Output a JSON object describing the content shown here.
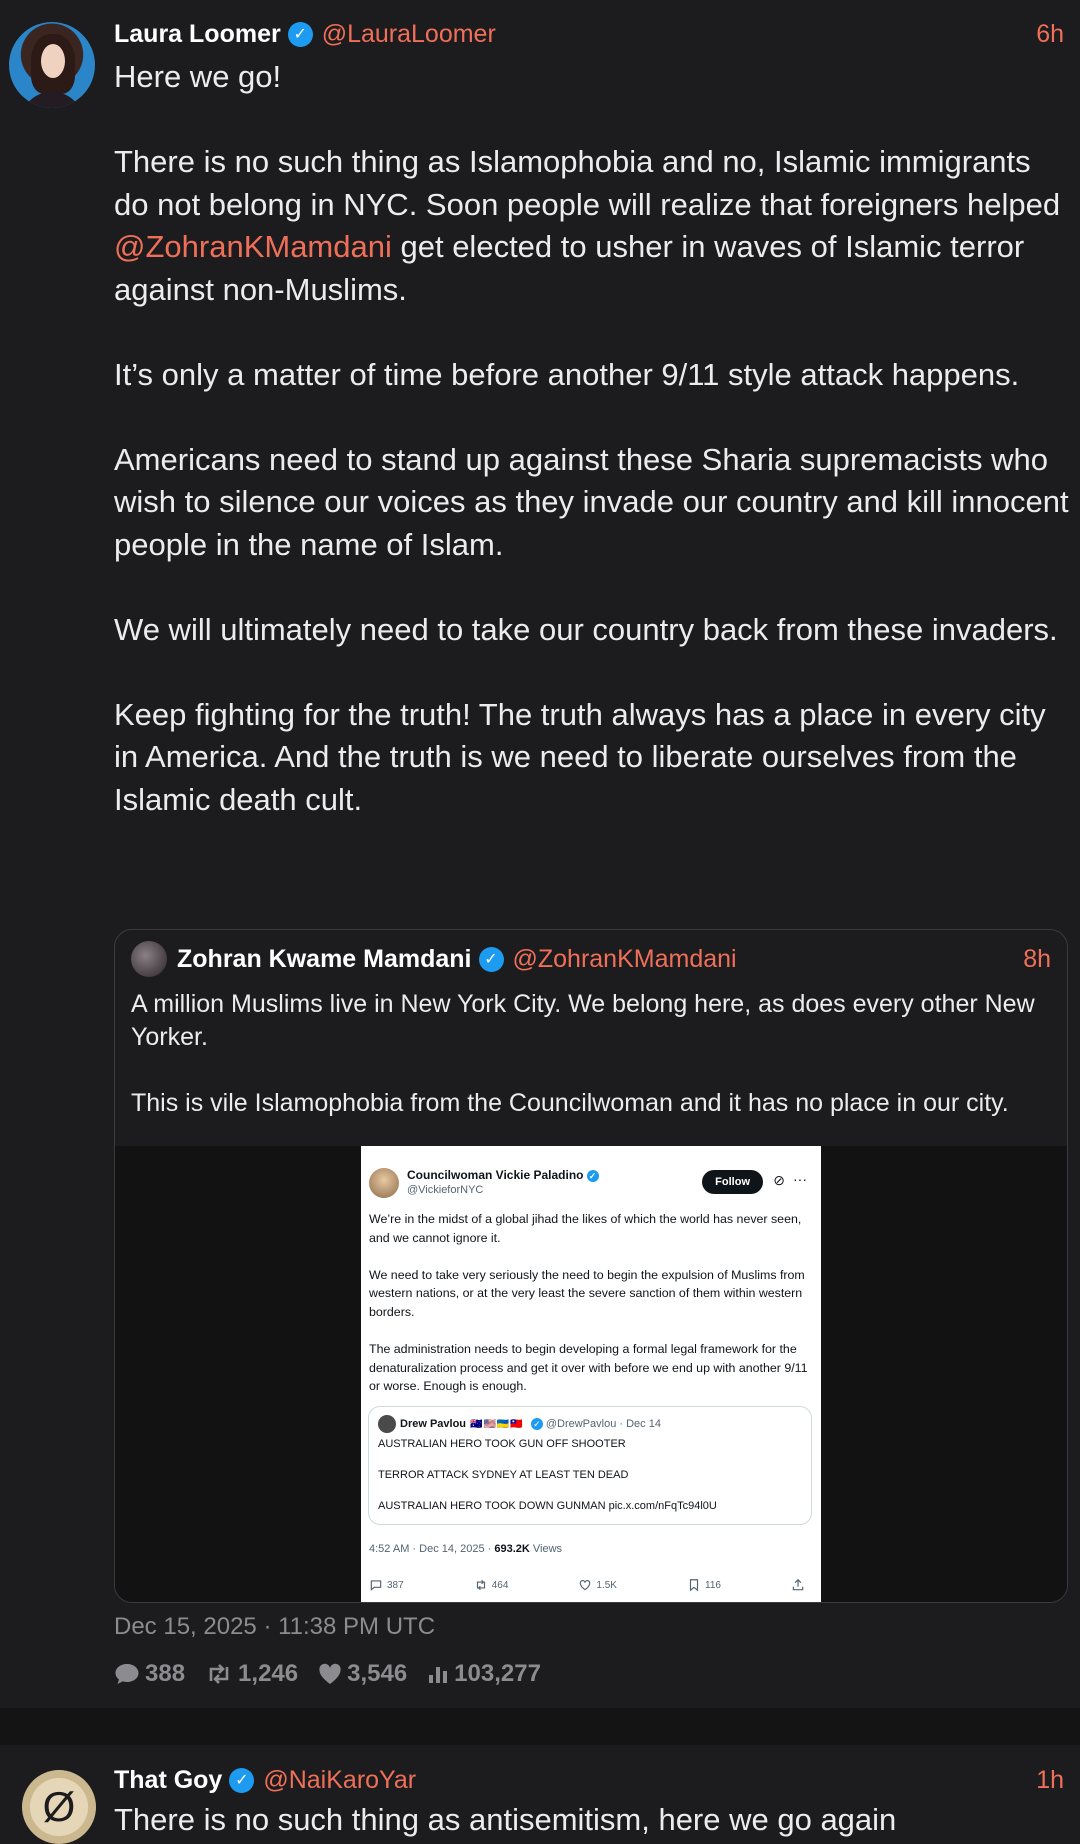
{
  "tweet": {
    "name": "Laura Loomer",
    "handle": "@LauraLoomer",
    "time": "6h",
    "text_1": "Here we go!\n\nThere is no such thing as Islamophobia and no, Islamic immigrants do not belong in NYC. Soon people will realize that foreigners helped ",
    "mention": "@ZohranKMamdani",
    "text_2": " get elected to usher in waves of Islamic terror against non-Muslims.\n\nIt’s only a matter of time before another 9/11 style attack happens.\n\nAmericans need to stand up against these Sharia supremacists who wish to silence our voices as they invade our country and kill innocent people in the name of Islam.\n\nWe will ultimately need to take our country back from these invaders.\n\nKeep fighting for the truth! The truth always has a place in every city in America. And the truth is we need to liberate ourselves from the Islamic death cult.",
    "date": "Dec 15, 2025 · 11:38 PM UTC",
    "stats": {
      "replies": "388",
      "retweets": "1,246",
      "likes": "3,546",
      "views": "103,277"
    }
  },
  "quote": {
    "name": "Zohran Kwame Mamdani",
    "handle": "@ZohranKMamdani",
    "time": "8h",
    "text": "A million Muslims live in New York City. We belong here, as does every other New Yorker.\n\nThis is vile Islamophobia from the Councilwoman and it has no place in our city."
  },
  "embedded": {
    "name": "Councilwoman Vickie Paladino",
    "handle": "@VickieforNYC",
    "follow": "Follow",
    "text": "We’re in the midst of a global jihad the likes of which the world has never seen, and we cannot ignore it.\n\nWe need to take very seriously the need to begin the expulsion of Muslims from western nations, or at the very least the severe sanction of them within western borders.\n\nThe administration needs to begin developing a formal legal framework for the denaturalization process and get it over with before we end up with another 9/11 or worse. Enough is enough.",
    "nested": {
      "name": "Drew Pavlou",
      "flags": "🇦🇺🇺🇸🇺🇦🇹🇼",
      "handle": "@DrewPavlou · Dec 14",
      "text": "AUSTRALIAN HERO TOOK GUN OFF SHOOTER\n\nTERROR ATTACK SYDNEY AT LEAST TEN DEAD\n\nAUSTRALIAN HERO TOOK DOWN GUNMAN pic.x.com/nFqTc94l0U"
    },
    "meta_time": "4:52 AM · Dec 14, 2025 · ",
    "meta_views": "693.2K",
    "meta_views_label": " Views",
    "actions": {
      "replies": "387",
      "retweets": "464",
      "likes": "1.5K",
      "bookmarks": "116"
    }
  },
  "tweet2": {
    "name": "That Goy",
    "handle": "@NaiKaroYar",
    "time": "1h",
    "text": "There is no such thing as antisemitism, here we go again"
  },
  "colors": {
    "background": "#1c1c1e",
    "accent": "#f06f58",
    "verified": "#1d9bf0"
  }
}
